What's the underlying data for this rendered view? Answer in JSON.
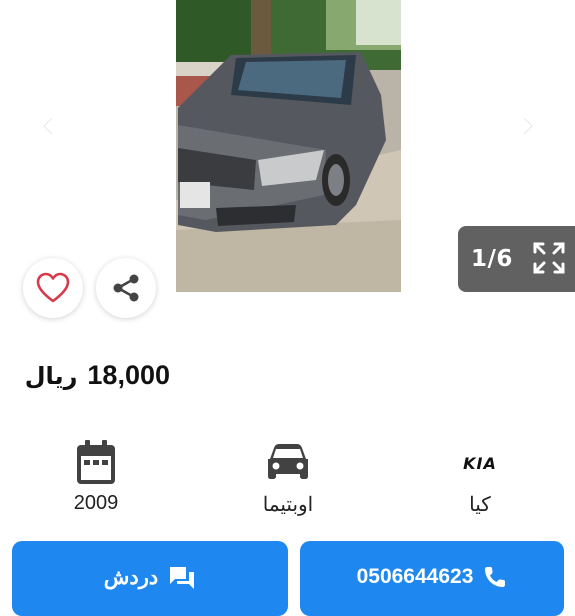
{
  "gallery": {
    "counter": "1/6",
    "icons": {
      "prev": "chevron-left-icon",
      "next": "chevron-right-icon",
      "expand": "expand-icon",
      "favorite": "heart-icon",
      "share": "share-icon"
    }
  },
  "listing": {
    "price_amount": "18,000",
    "price_currency": "ريال",
    "specs": {
      "year": "2009",
      "model": "اوبتيما",
      "make": "كيا",
      "make_logo_text": "KIA"
    }
  },
  "actions": {
    "chat_label": "دردش",
    "call_label": "0506644623"
  },
  "colors": {
    "primary": "#1e88f0",
    "heart": "#d83a4a",
    "counter_bg": "#616161"
  }
}
